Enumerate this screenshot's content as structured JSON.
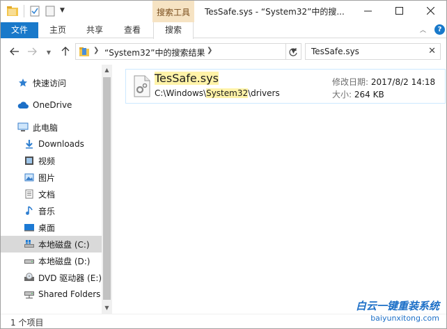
{
  "window": {
    "title": "“System32”中的搜...",
    "context_tab": "搜索工具"
  },
  "ribbon": {
    "tabs": [
      {
        "label": "文件"
      },
      {
        "label": "主页"
      },
      {
        "label": "共享"
      },
      {
        "label": "查看"
      },
      {
        "label": "搜索"
      }
    ]
  },
  "address": {
    "path": "“System32”中的搜索结果",
    "search_value": "TesSafe.sys"
  },
  "sidebar": {
    "items": [
      {
        "label": "快速访问",
        "icon": "star-icon"
      },
      {
        "label": "OneDrive",
        "icon": "cloud-icon"
      },
      {
        "label": "此电脑",
        "icon": "computer-icon"
      },
      {
        "label": "Downloads",
        "icon": "download-icon"
      },
      {
        "label": "视频",
        "icon": "video-icon"
      },
      {
        "label": "图片",
        "icon": "picture-icon"
      },
      {
        "label": "文档",
        "icon": "document-icon"
      },
      {
        "label": "音乐",
        "icon": "music-icon"
      },
      {
        "label": "桌面",
        "icon": "desktop-icon"
      },
      {
        "label": "本地磁盘 (C:)",
        "icon": "drive-icon"
      },
      {
        "label": "本地磁盘 (D:)",
        "icon": "drive-icon"
      },
      {
        "label": "DVD 驱动器 (E:)",
        "icon": "dvd-icon"
      },
      {
        "label": "Shared Folders",
        "icon": "network-drive-icon"
      }
    ]
  },
  "result": {
    "name": "TesSafe.sys",
    "path_prefix": "C:\\Windows\\",
    "path_highlight": "System32",
    "path_suffix": "\\drivers",
    "date_label": "修改日期:",
    "date_value": "2017/8/2 14:18",
    "size_label": "大小:",
    "size_value": "264 KB"
  },
  "status": {
    "count": "1 个项目"
  },
  "watermark": {
    "line1": "白云一键重装系统",
    "line2": "baiyunxitong.com"
  },
  "colors": {
    "accent": "#1979ca",
    "context_tab": "#f6e3c3",
    "highlight": "#fff3a8",
    "selection": "#cce8ff"
  }
}
